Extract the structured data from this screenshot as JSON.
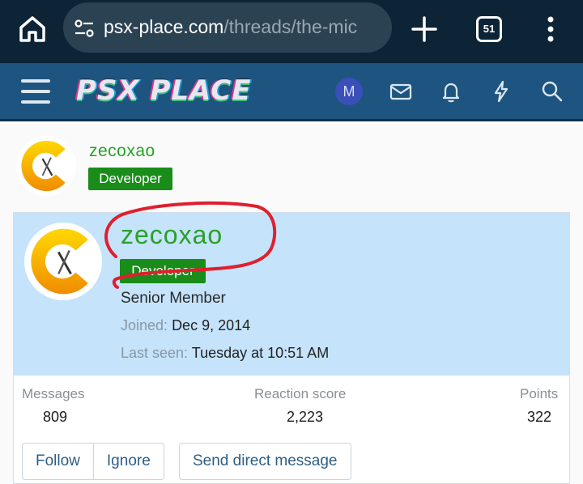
{
  "browser": {
    "url_host": "psx-place.com",
    "url_path": "/threads/the-mic",
    "tab_count": "51"
  },
  "site": {
    "logo_text": "PSX PLACE",
    "user_avatar_letter": "M"
  },
  "post": {
    "username": "zecoxao",
    "badge": "Developer"
  },
  "member_card": {
    "username": "zecoxao",
    "badge": "Developer",
    "title": "Senior Member",
    "joined_label": "Joined:",
    "joined_value": "Dec 9, 2014",
    "last_seen_label": "Last seen:",
    "last_seen_value": "Tuesday at 10:51 AM",
    "stats": [
      {
        "label": "Messages",
        "value": "809"
      },
      {
        "label": "Reaction score",
        "value": "2,223"
      },
      {
        "label": "Points",
        "value": "322"
      }
    ],
    "buttons": {
      "follow": "Follow",
      "ignore": "Ignore",
      "send_message": "Send direct message"
    }
  },
  "colors": {
    "username_green": "#2aa02a",
    "badge_green": "#198c19",
    "header_blue": "#1d5580",
    "card_blue": "#c5e3fa",
    "annotation_red": "#e01f2e"
  }
}
